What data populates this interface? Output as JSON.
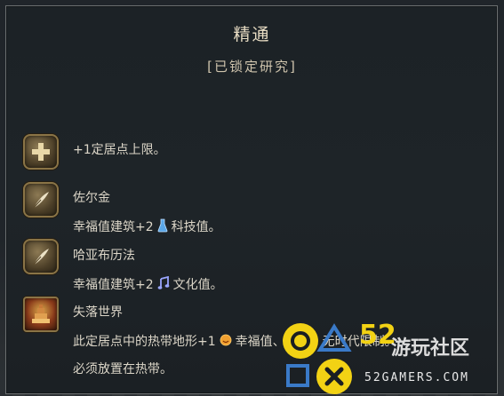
{
  "tooltip": {
    "title": "精通",
    "subtitle": "[已锁定研究]",
    "entries": [
      {
        "icon": "plus-icon",
        "lines": [
          "+1定居点上限。"
        ]
      },
      {
        "icon": "quill-icon",
        "name": "佐尔金",
        "effect_prefix": "幸福值建筑+2",
        "effect_icon": "science-flask-icon",
        "effect_suffix": "科技值。"
      },
      {
        "icon": "quill-icon",
        "name": "哈亚布历法",
        "effect_prefix": "幸福值建筑+2",
        "effect_icon": "music-note-icon",
        "effect_suffix": "文化值。"
      },
      {
        "icon": "temple-icon",
        "name": "失落世界",
        "effect_prefix": "此定居点中的热带地形+1",
        "effect_icon": "happiness-icon",
        "effect_suffix": "幸福值、科技、无时代限制。",
        "line2": "必须放置在热带。"
      }
    ]
  },
  "watermark": {
    "number": "52",
    "cn": "游玩社区",
    "site": "52GAMERS.COM"
  },
  "colors": {
    "accent": "#e7dcc3",
    "text": "#dcd6c8",
    "badge_gold": "#8a7446",
    "watermark_yellow": "#f2d214"
  }
}
